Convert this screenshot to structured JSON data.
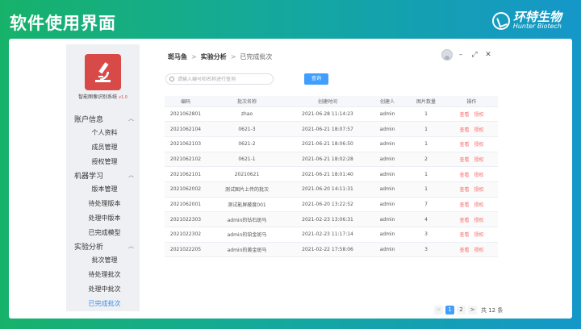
{
  "slide": {
    "title": "软件使用界面",
    "brand_cn": "环特生物",
    "brand_en": "Hunter Biotech"
  },
  "app": {
    "name": "智能图像识别系统",
    "version": "v1.0"
  },
  "sidebar": {
    "groups": [
      {
        "label": "账户信息",
        "items": [
          "个人资料",
          "成员管理",
          "授权管理"
        ]
      },
      {
        "label": "机器学习",
        "items": [
          "版本管理",
          "待处理版本",
          "处理中版本",
          "已完成模型"
        ]
      },
      {
        "label": "实验分析",
        "items": [
          "批次管理",
          "待处理批次",
          "处理中批次",
          "已完成批次"
        ]
      }
    ],
    "active_item": "已完成批次"
  },
  "breadcrumb": [
    "斑马鱼",
    "实验分析",
    "已完成批次"
  ],
  "window": {
    "min": "–",
    "max": "⤢",
    "close": "✕"
  },
  "search": {
    "placeholder": "请输入编号和名称进行查询",
    "button": "查询"
  },
  "table": {
    "columns": [
      "编码",
      "批次名称",
      "创建时间",
      "创建人",
      "图片数量",
      "操作"
    ],
    "actions": [
      "查看",
      "授权"
    ],
    "rows": [
      [
        "2021062801",
        "zhao",
        "2021-06-28 11:14:23",
        "admin",
        "1"
      ],
      [
        "2021062104",
        "0621-3",
        "2021-06-21 18:07:57",
        "admin",
        "1"
      ],
      [
        "2021062103",
        "0621-2",
        "2021-06-21 18:06:50",
        "admin",
        "1"
      ],
      [
        "2021062102",
        "0621-1",
        "2021-06-21 18:02:28",
        "admin",
        "2"
      ],
      [
        "2021062101",
        "20210621",
        "2021-06-21 18:01:40",
        "admin",
        "1"
      ],
      [
        "2021062002",
        "测试图片上传的批次",
        "2021-06-20 14:11:31",
        "admin",
        "1"
      ],
      [
        "2021062001",
        "测试能屏蔽度001",
        "2021-06-20 13:22:52",
        "admin",
        "7"
      ],
      [
        "2021022303",
        "admin的钻石斑马",
        "2021-02-23 13:06:31",
        "admin",
        "4"
      ],
      [
        "2021022302",
        "admin的铂金斑马",
        "2021-02-23 11:17:14",
        "admin",
        "3"
      ],
      [
        "2021022205",
        "admin的黄金斑马",
        "2021-02-22 17:58:06",
        "admin",
        "3"
      ]
    ]
  },
  "pagination": {
    "prev": "<",
    "pages": [
      "1",
      "2"
    ],
    "current": "1",
    "next": ">",
    "total": "共 12 条"
  }
}
